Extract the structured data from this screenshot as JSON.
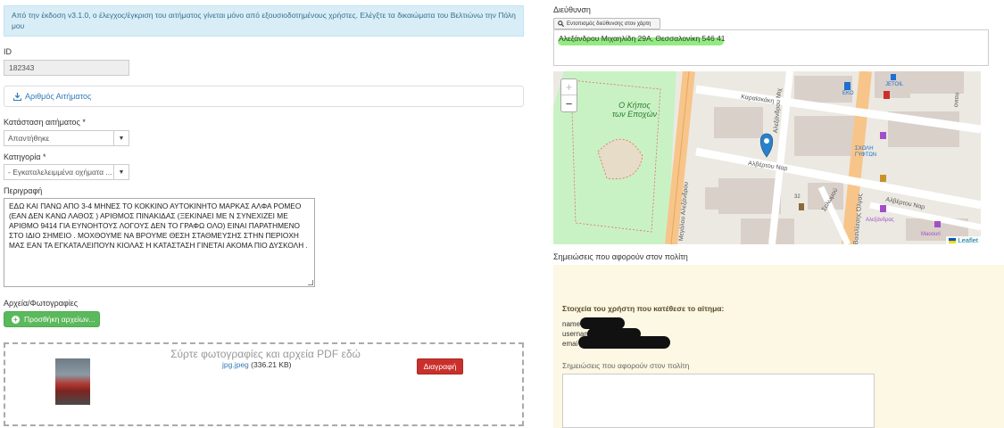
{
  "alert": {
    "text": "Από την έκδοση v3.1.0, ο έλεγχος/έγκριση του αιτήματος γίνεται μόνο από εξουσιοδοτημένους χρήστες. Ελέγξτε τα δικαιώματα του Βελτιώνω την Πόλη μου"
  },
  "id_field": {
    "label": "ID",
    "value": "182343"
  },
  "request_number": {
    "label": "Αριθμός Αιτήματος"
  },
  "status": {
    "label": "Κατάσταση αιτήματος *",
    "value": "Απαντήθηκε"
  },
  "category": {
    "label": "Κατηγορία *",
    "value": "- Εγκαταλελειμμένα οχήματα ..."
  },
  "description": {
    "label": "Περιγραφή",
    "text": "ΕΔΩ ΚΑΙ ΠΑΝΩ ΑΠΟ 3-4 ΜΗΝΕΣ ΤΟ ΚΟΚΚΙΝΟ ΑΥΤΟΚΙΝΗΤΟ  ΜΑΡΚΑΣ ΑΛΦΑ ΡΟΜΕΟ (ΕΑΝ ΔΕΝ ΚΑΝΩ ΛΑΘΟΣ ) ΑΡΙΘΜΟΣ ΠΙΝΑΚΙΔΑΣ (ΞΕΚΙΝΑΕΙ ΜΕ Ν  ΣΥΝΕΧΙΖΕΙ ΜΕ ΑΡΙΘΜΟ 9414 ΓΙΑ ΕΥΝΟΗΤΟΥΣ ΛΟΓΟΥΣ ΔΕΝ ΤΟ ΓΡΑΦΩ ΟΛΟ) ΕΙΝΑΙ ΠΑΡΑΤΗΜΕΝΟ ΣΤΟ ΙΔΙΟ ΣΗΜΕΙΟ . ΜΟΧΘΟΥΜΕ ΝΑ ΒΡΟΥΜΕ ΘΕΣΗ ΣΤΑΘΜΕΥΣΗΣ ΣΤΗΝ ΠΕΡΙΟΧΗ ΜΑΣ  ΕΑΝ ΤΑ ΕΓΚΑΤΑΛΕΙΠΟΥΝ ΚΙΟΛΑΣ Η ΚΑΤΑΣΤΑΣΗ ΓΙΝΕΤΑΙ ΑΚΟΜΑ ΠΙΟ ΔΥΣΚΟΛΗ ."
  },
  "files": {
    "label": "Αρχεία/Φωτογραφίες",
    "add_button": "Προσθήκη αρχείων...",
    "dropzone_text": "Σύρτε φωτογραφίες και αρχεία PDF εδώ",
    "file_name": "jpg.jpeg",
    "file_size": "(336.21 KB)",
    "delete_button": "Διαγραφή"
  },
  "address": {
    "label": "Διεύθυνση",
    "locate_button": "Εντοπισμός διεύθυνσης στον χάρτη",
    "value": "Αλεξάνδρου Μιχαηλίδη 29Α, Θεσσαλονίκη 546 41"
  },
  "map": {
    "zoom_in": "+",
    "zoom_out": "−",
    "attribution": "Leaflet",
    "labels": {
      "park": "Ο Κήπος",
      "park2": "των Εποχών",
      "karaiskaki": "Καραϊσκάκη",
      "alexandrou_m": "Αλεξάνδρου Μιχ",
      "alvertou": "Αλβέρτου Ναρ",
      "alvertou2": "Αλβέρτου Ναρ",
      "megalou": "Μεγάλου Αλεξάνδρου",
      "solomou": "Σολωμού",
      "olgas": "Βασιλίσσης Όλγας",
      "eko": "ΕΚΟ",
      "jetoil": "JETOIL",
      "school": "ΣΧΟΛΗ",
      "school2": "ΓΥΦΤΩΝ",
      "alexandras": "Αλεξάνδρας",
      "maoouri": "Maoouri",
      "num32": "32",
      "kolokotroni": "ονιου"
    }
  },
  "citizen_notes": {
    "label": "Σημειώσεις που αφορούν στον πολίτη",
    "user_title": "Στοιχεία του χρήστη που κατέθεσε το αίτημα:",
    "name_label": "name",
    "username_label": "usernam",
    "email_label": "emai",
    "sub_label": "Σημειώσεις που αφορούν στον πολίτη"
  }
}
